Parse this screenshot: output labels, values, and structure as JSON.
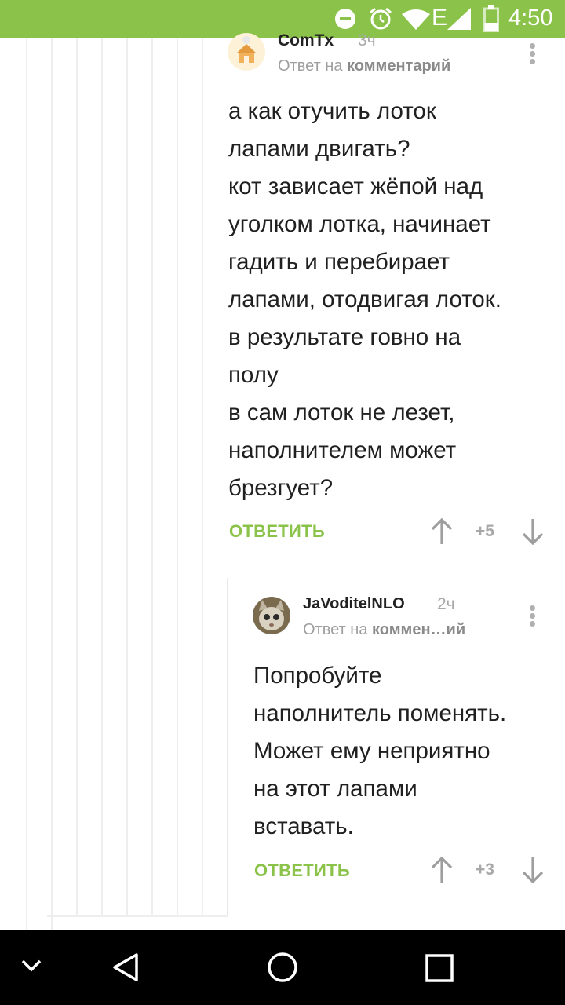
{
  "status_bar": {
    "time": "4:50",
    "network": "E"
  },
  "comments": [
    {
      "author": "ComTx",
      "time": "3ч",
      "reply_prefix": "Ответ на",
      "reply_target": "комментарий",
      "text": "а как отучить лоток\nлапами двигать?\nкот зависает жёпой над\nуголком лотка, начинает\nгадить и перебирает\nлапами, отодвигая лоток.\nв результате говно на\nполу\nв сам лоток не лезет,\nнаполнителем может\nбрезгует?",
      "reply_label": "ОТВЕТИТЬ",
      "score": "+5"
    },
    {
      "author": "JaVoditelNLO",
      "time": "2ч",
      "reply_prefix": "Ответ на",
      "reply_target": "коммен…ий",
      "text": "Попробуйте\nнаполнитель поменять.\nМожет ему неприятно\nна этот лапами\nвставать.",
      "reply_label": "ОТВЕТИТЬ",
      "score": "+3"
    }
  ]
}
